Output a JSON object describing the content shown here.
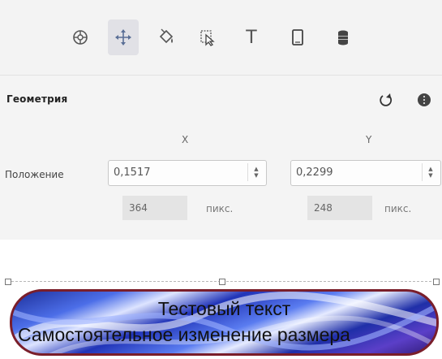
{
  "toolbar": {
    "tools": [
      {
        "icon": "layout-icon",
        "active": false
      },
      {
        "icon": "move-icon",
        "active": true
      },
      {
        "icon": "fill-bucket-icon",
        "active": false
      },
      {
        "icon": "pointer-icon",
        "active": false
      },
      {
        "icon": "text-icon",
        "active": false
      },
      {
        "icon": "phone-icon",
        "active": false
      },
      {
        "icon": "database-icon",
        "active": false
      }
    ],
    "text_tool_glyph": "T"
  },
  "geometry": {
    "title": "Геометрия",
    "x_axis_label": "X",
    "y_axis_label": "Y",
    "position_label": "Положение",
    "x_value": "0,1517",
    "y_value": "0,2299",
    "x_pixels": "364",
    "y_pixels": "248",
    "pixel_unit": "пикс."
  },
  "canvas": {
    "banner_line1": "Тестовый текст",
    "banner_line2": "Самостоятельное изменение размера",
    "border_color": "#7a1e2a"
  }
}
